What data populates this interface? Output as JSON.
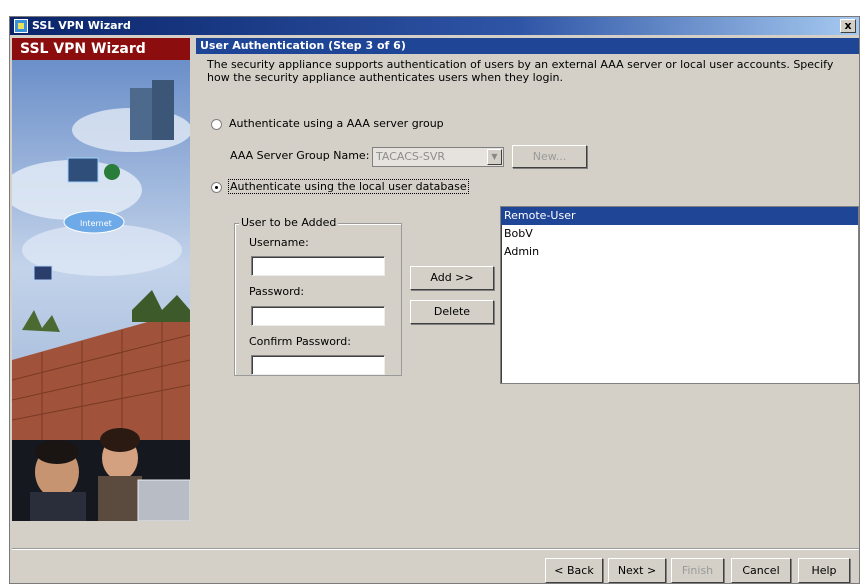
{
  "window": {
    "title": "SSL VPN Wizard",
    "close_label": "x"
  },
  "sidebar": {
    "header": "SSL VPN Wizard",
    "art_label": "Internet"
  },
  "step": {
    "title": "User Authentication  (Step 3 of 6)"
  },
  "description": "The security appliance supports authentication of users by an external AAA server or local user accounts. Specify how the security appliance authenticates users when they login.",
  "auth": {
    "aaa_option": "Authenticate using a AAA server group",
    "server_group_label": "AAA Server Group Name:",
    "server_group_value": "TACACS-SVR",
    "new_button": "New...",
    "local_option": "Authenticate using the local user database",
    "selected": "local"
  },
  "user_form": {
    "legend": "User to be Added",
    "username_label": "Username:",
    "username_value": "",
    "password_label": "Password:",
    "password_value": "",
    "confirm_label": "Confirm Password:",
    "confirm_value": ""
  },
  "actions": {
    "add": "Add >>",
    "delete": "Delete"
  },
  "users": [
    "Remote-User",
    "BobV",
    "Admin"
  ],
  "footer": {
    "back": "< Back",
    "next": "Next >",
    "finish": "Finish",
    "cancel": "Cancel",
    "help": "Help"
  },
  "colors": {
    "title_bar": "#0a246a",
    "step_header": "#1f4596",
    "sidebar_header": "#8b0d0d",
    "selection": "#1f4596"
  }
}
